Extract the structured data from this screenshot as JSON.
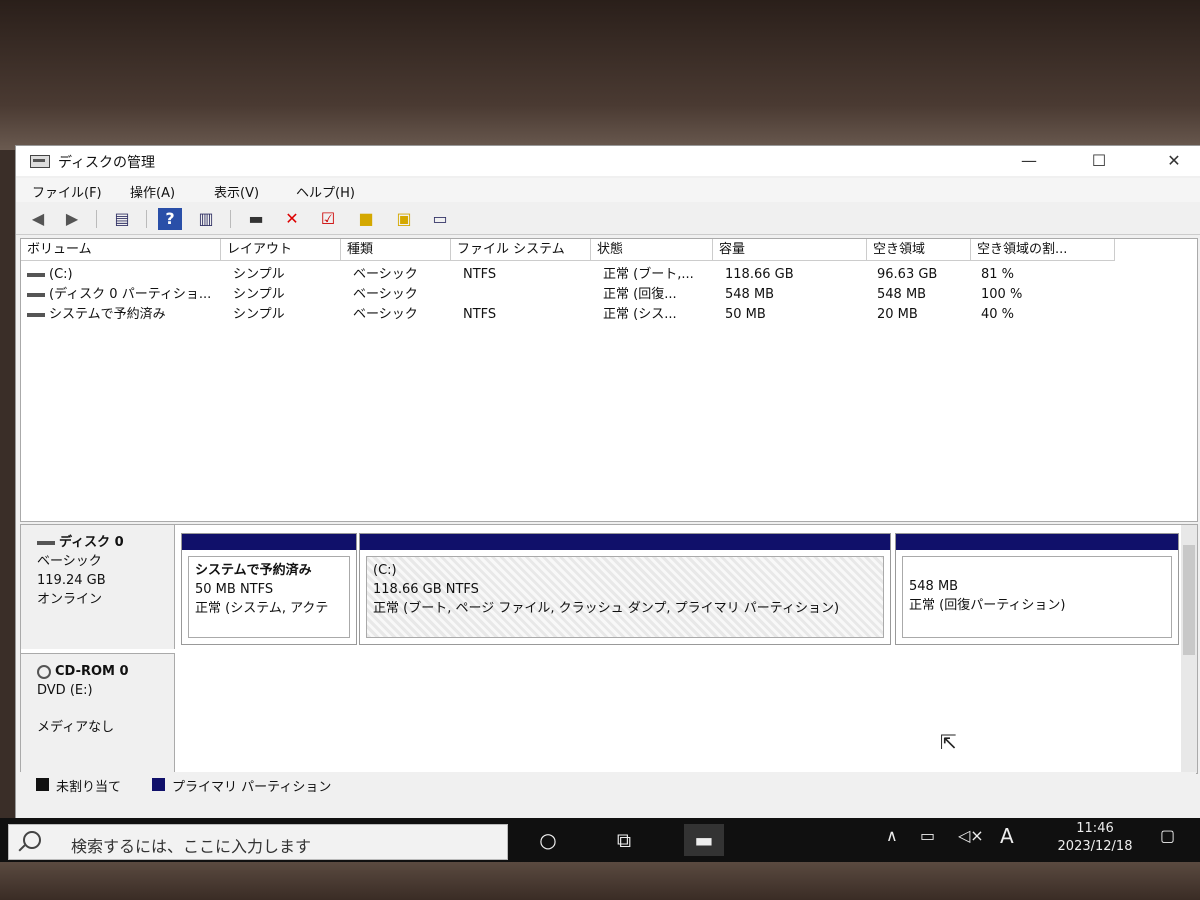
{
  "window": {
    "title": "ディスクの管理",
    "controls": {
      "minimize": "—",
      "maximize": "☐",
      "close": "✕"
    }
  },
  "menu": [
    "ファイル(F)",
    "操作(A)",
    "表示(V)",
    "ヘルプ(H)"
  ],
  "toolbar_icons": [
    "back-icon",
    "forward-icon",
    "console-tree-icon",
    "help-icon",
    "properties-icon",
    "connect-icon",
    "delete-icon",
    "check-icon",
    "new-folder-icon",
    "search-folder-icon",
    "view-icon"
  ],
  "volume_columns": [
    "ボリューム",
    "レイアウト",
    "種類",
    "ファイル システム",
    "状態",
    "容量",
    "空き領域",
    "空き領域の割..."
  ],
  "volumes": [
    {
      "name": "(C:)",
      "layout": "シンプル",
      "type": "ベーシック",
      "fs": "NTFS",
      "status": "正常 (ブート,...",
      "capacity": "118.66 GB",
      "free": "96.63 GB",
      "pct": "81 %"
    },
    {
      "name": "(ディスク 0 パーティショ...",
      "layout": "シンプル",
      "type": "ベーシック",
      "fs": "",
      "status": "正常 (回復...",
      "capacity": "548 MB",
      "free": "548 MB",
      "pct": "100 %"
    },
    {
      "name": "システムで予約済み",
      "layout": "シンプル",
      "type": "ベーシック",
      "fs": "NTFS",
      "status": "正常 (シス...",
      "capacity": "50 MB",
      "free": "20 MB",
      "pct": "40 %"
    }
  ],
  "disk0": {
    "name": "ディスク 0",
    "kind": "ベーシック",
    "size": "119.24 GB",
    "state": "オンライン",
    "partitions": [
      {
        "line1": "システムで予約済み",
        "line2": "50 MB NTFS",
        "line3": "正常 (システム, アクテ"
      },
      {
        "line1": "(C:)",
        "line2": "118.66 GB NTFS",
        "line3": "正常 (ブート, ページ ファイル, クラッシュ ダンプ, プライマリ パーティション)"
      },
      {
        "line1": "548 MB",
        "line2": "正常 (回復パーティション)",
        "line3": ""
      }
    ]
  },
  "cdrom": {
    "name": "CD-ROM 0",
    "drive": "DVD (E:)",
    "media": "メディアなし"
  },
  "legend": {
    "unallocated": "未割り当て",
    "primary": "プライマリ パーティション"
  },
  "colors": {
    "unallocated": "#111111",
    "primary": "#10106a"
  },
  "taskbar": {
    "search_placeholder": "検索するには、ここに入力します",
    "ime": "A",
    "time": "11:46",
    "date": "2023/12/18"
  }
}
